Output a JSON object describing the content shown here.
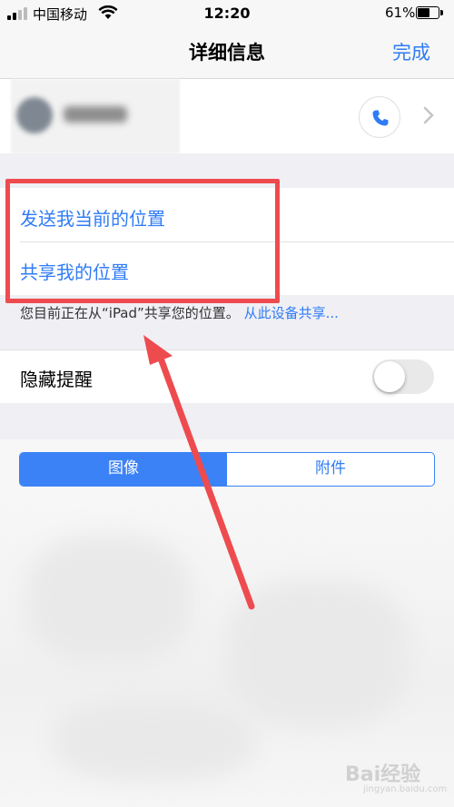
{
  "status_bar": {
    "carrier": "中国移动",
    "time": "12:20",
    "battery_percent": "61%",
    "battery_level": 0.61,
    "icons": [
      "signal-icon",
      "wifi-icon",
      "battery-icon"
    ]
  },
  "nav": {
    "title": "详细信息",
    "done_label": "完成"
  },
  "contact": {
    "icons": [
      "avatar",
      "phone-icon",
      "chevron-right-icon"
    ]
  },
  "location": {
    "send_current": "发送我当前的位置",
    "share_my_location": "共享我的位置",
    "footer_text": "您目前正在从“iPad”共享您的位置。",
    "footer_link": "从此设备共享..."
  },
  "hide_alerts": {
    "label": "隐藏提醒",
    "enabled": false
  },
  "segments": {
    "images": "图像",
    "attachments": "附件",
    "selected": "图像"
  },
  "colors": {
    "accent": "#2f7cf6",
    "annotation": "#ee4b4f"
  },
  "watermark": {
    "brand": "Bai经验",
    "url": "jingyan.baidu.com"
  }
}
